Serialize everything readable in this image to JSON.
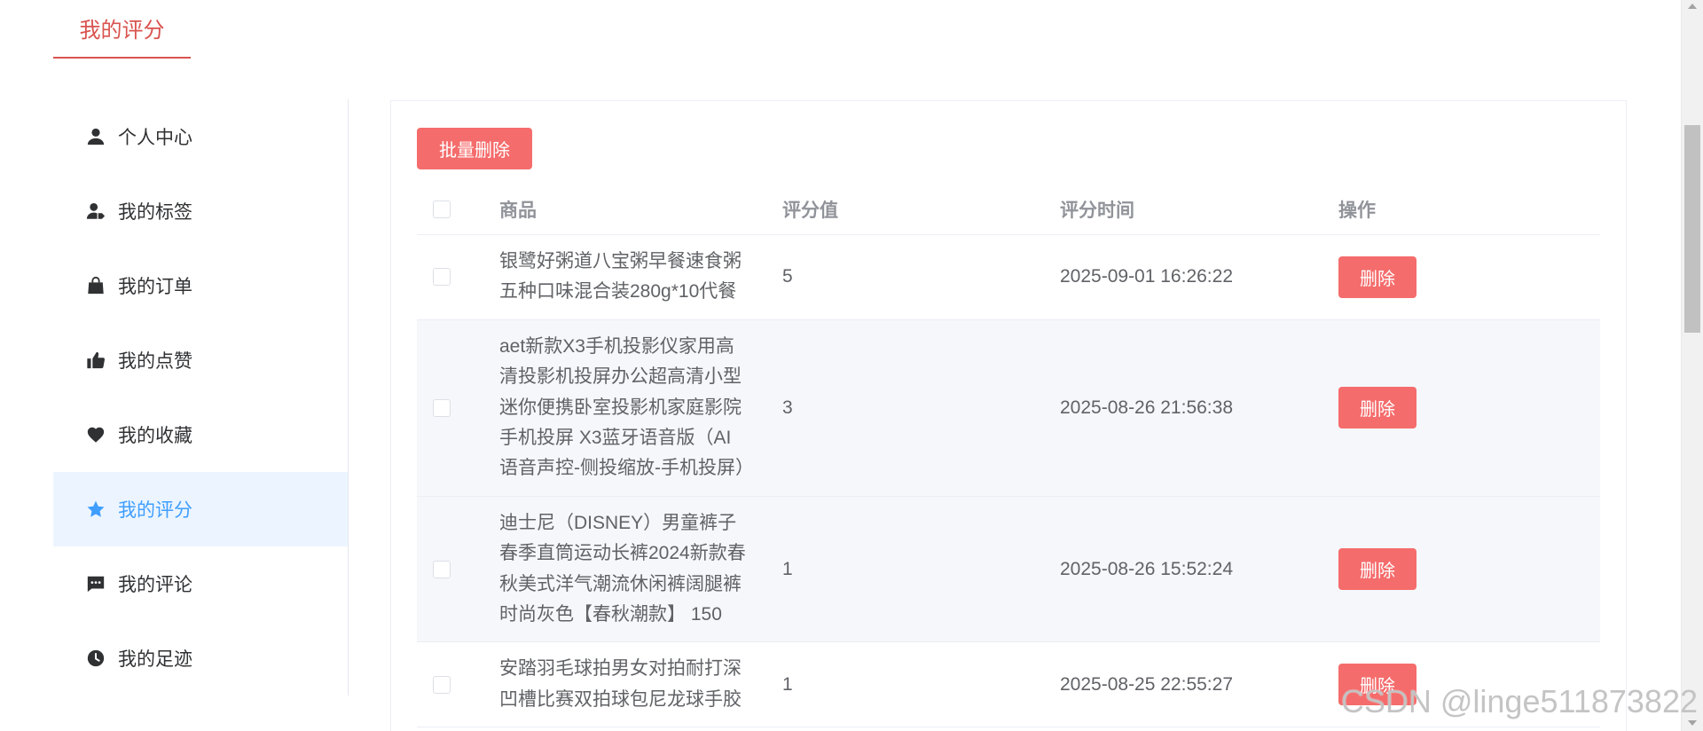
{
  "page": {
    "tab_title": "我的评分"
  },
  "colors": {
    "accent": "#f56c6c",
    "active": "#409eff",
    "tab": "#d9534f"
  },
  "sidebar": {
    "items": [
      {
        "label": "个人中心",
        "icon": "user-icon",
        "active": false
      },
      {
        "label": "我的标签",
        "icon": "user-tag-icon",
        "active": false
      },
      {
        "label": "我的订单",
        "icon": "shopping-bag-icon",
        "active": false
      },
      {
        "label": "我的点赞",
        "icon": "thumbs-up-icon",
        "active": false
      },
      {
        "label": "我的收藏",
        "icon": "heart-icon",
        "active": false
      },
      {
        "label": "我的评分",
        "icon": "star-icon",
        "active": true
      },
      {
        "label": "我的评论",
        "icon": "comment-icon",
        "active": false
      },
      {
        "label": "我的足迹",
        "icon": "clock-icon",
        "active": false
      }
    ]
  },
  "toolbar": {
    "batch_delete_label": "批量删除"
  },
  "table": {
    "columns": {
      "product": "商品",
      "rating": "评分值",
      "rated_at": "评分时间",
      "actions": "操作"
    },
    "rows": [
      {
        "product": "银鹭好粥道八宝粥早餐速食粥五种口味混合装280g*10代餐",
        "rating": 5,
        "rated_at": "2025-09-01 16:26:22",
        "delete_label": "删除"
      },
      {
        "product": "aet新款X3手机投影仪家用高清投影机投屏办公超高清小型迷你便携卧室投影机家庭影院手机投屏 X3蓝牙语音版（AI语音声控-侧投缩放-手机投屏）",
        "rating": 3,
        "rated_at": "2025-08-26 21:56:38",
        "delete_label": "删除"
      },
      {
        "product": "迪士尼（DISNEY）男童裤子春季直筒运动长裤2024新款春秋美式洋气潮流休闲裤阔腿裤时尚灰色【春秋潮款】 150",
        "rating": 1,
        "rated_at": "2025-08-26 15:52:24",
        "delete_label": "删除"
      },
      {
        "product": "安踏羽毛球拍男女对拍耐打深凹槽比赛双拍球包尼龙球手胶",
        "rating": 1,
        "rated_at": "2025-08-25 22:55:27",
        "delete_label": "删除"
      }
    ]
  },
  "watermark": "CSDN @linge511873822"
}
